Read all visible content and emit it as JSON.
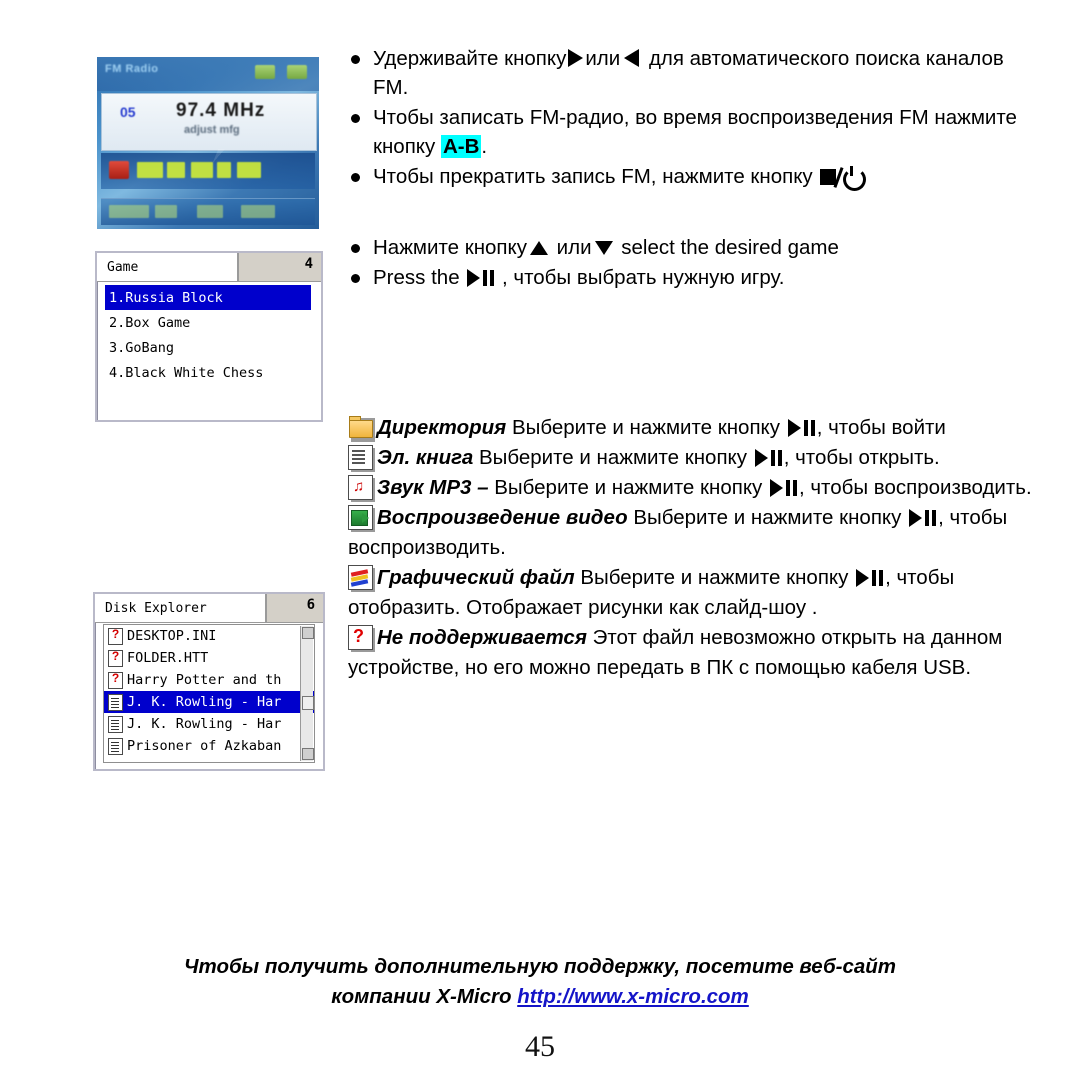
{
  "page_number": "45",
  "fm_screen": {
    "title": "FM Radio",
    "preset": "05",
    "frequency": "97.4 MHz",
    "subtext": "adjust mfg"
  },
  "game_screen": {
    "tab_label": "Game",
    "count": "4",
    "items": [
      {
        "label": "1.Russia Block",
        "selected": true
      },
      {
        "label": "2.Box Game",
        "selected": false
      },
      {
        "label": "3.GoBang",
        "selected": false
      },
      {
        "label": "4.Black White Chess",
        "selected": false
      }
    ]
  },
  "disk_screen": {
    "tab_label": "Disk Explorer",
    "count": "6",
    "items": [
      {
        "label": "DESKTOP.INI",
        "icon": "unknown-file-icon",
        "selected": false
      },
      {
        "label": "FOLDER.HTT",
        "icon": "unknown-file-icon",
        "selected": false
      },
      {
        "label": "Harry Potter and th",
        "icon": "unknown-file-icon",
        "selected": false
      },
      {
        "label": "J. K. Rowling - Har",
        "icon": "text-file-icon",
        "selected": true
      },
      {
        "label": "J. K. Rowling - Har",
        "icon": "text-file-icon",
        "selected": false
      },
      {
        "label": "Prisoner of Azkaban",
        "icon": "text-file-icon",
        "selected": false
      }
    ]
  },
  "fm_bullets": {
    "b1_part1": "Удерживайте кнопку",
    "b1_part2": "или",
    "b1_part3": "для автоматического поиска каналов FM.",
    "b2_part1": "Чтобы записать FM-радио, во время воспроизведения FM нажмите кнопку",
    "b2_button": "A-B",
    "b2_tail": ".",
    "b3_part1": "Чтобы прекратить запись FM, нажмите кнопку"
  },
  "game_bullets": {
    "b1_part1": "Нажмите кнопку",
    "b1_part2": "или",
    "b1_part3": "select the desired game",
    "b2_part1": "Press the",
    "b2_part2": ", чтобы выбрать нужную игру."
  },
  "file_types": [
    {
      "icon": "folder-icon",
      "heading": "Директория",
      "text_before": "Выберите и нажмите кнопку",
      "text_after": ", чтобы войти"
    },
    {
      "icon": "ebook-icon",
      "heading": "Эл. книга",
      "text_before": "Выберите и нажмите кнопку",
      "text_after": ", чтобы открыть."
    },
    {
      "icon": "mp3-icon",
      "heading": "Звук MP3 –",
      "text_before": "Выберите и нажмите кнопку",
      "text_after": ", чтобы воспроизводить."
    },
    {
      "icon": "video-icon",
      "heading": "Воспроизведение видео",
      "text_before": "Выберите и нажмите кнопку",
      "text_after": ", чтобы воспроизводить."
    },
    {
      "icon": "graphics-icon",
      "heading": "Графический файл",
      "text_before": "Выберите и нажмите кнопку",
      "text_after": ", чтобы отобразить. Отображает рисунки как слайд-шоу ."
    },
    {
      "icon": "unsupported-icon",
      "heading": "Не поддерживается",
      "text_before": "Этот файл невозможно открыть на данном устройстве, но его можно передать в ПК с помощью кабеля USB.",
      "text_after": ""
    }
  ],
  "footer": {
    "line1": "Чтобы получить дополнительную поддержку, посетите веб-сайт",
    "line2_prefix": "компании X-Micro",
    "url": "http://www.x-micro.com"
  },
  "colors": {
    "highlight": "#00ffff",
    "link": "#1414c8",
    "lcd_select": "#0000cc"
  }
}
